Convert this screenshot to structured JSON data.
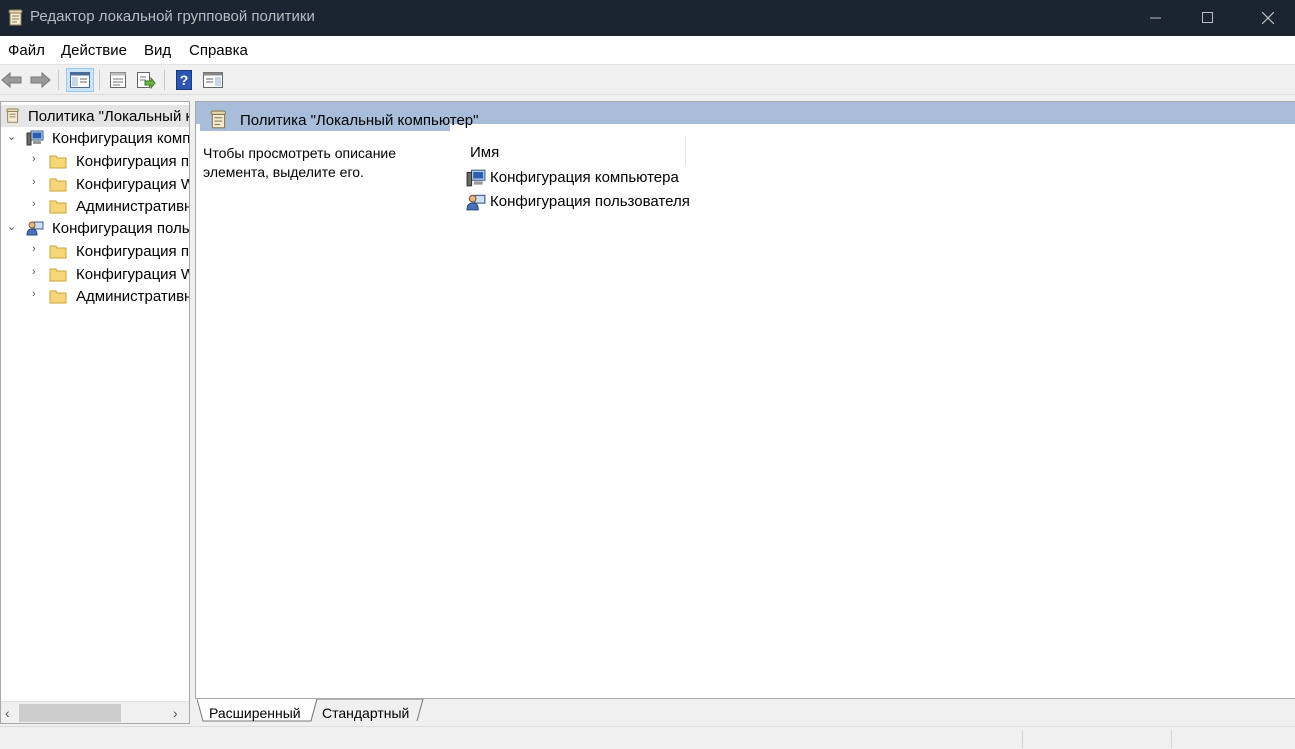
{
  "window": {
    "title": "Редактор локальной групповой политики",
    "minimize_icon": "minimize-icon",
    "maximize_icon": "maximize-icon",
    "close_icon": "close-icon"
  },
  "menu": [
    "Файл",
    "Действие",
    "Вид",
    "Справка"
  ],
  "toolbar": {
    "buttons": [
      "back-arrow-icon",
      "forward-arrow-icon",
      "show-hide-console-tree-icon",
      "properties-icon",
      "export-list-icon",
      "help-icon",
      "show-hide-action-pane-icon"
    ]
  },
  "tree": {
    "root": "Политика \"Локальный компьютер\"",
    "computer": {
      "label": "Конфигурация компьютера",
      "children": [
        "Конфигурация программ",
        "Конфигурация Windows",
        "Административные шаблоны"
      ]
    },
    "user": {
      "label": "Конфигурация пользователя",
      "children": [
        "Конфигурация программ",
        "Конфигурация Windows",
        "Административные шаблоны"
      ]
    }
  },
  "details": {
    "header": "Политика \"Локальный компьютер\"",
    "description": "Чтобы просмотреть описание элемента, выделите его.",
    "column_name": "Имя",
    "items": [
      "Конфигурация компьютера",
      "Конфигурация пользователя"
    ]
  },
  "tabs": [
    "Расширенный",
    "Стандартный"
  ],
  "colors": {
    "titlebar": "#1b2431",
    "header": "#a7bdd9",
    "selection": "#cce4f7"
  }
}
